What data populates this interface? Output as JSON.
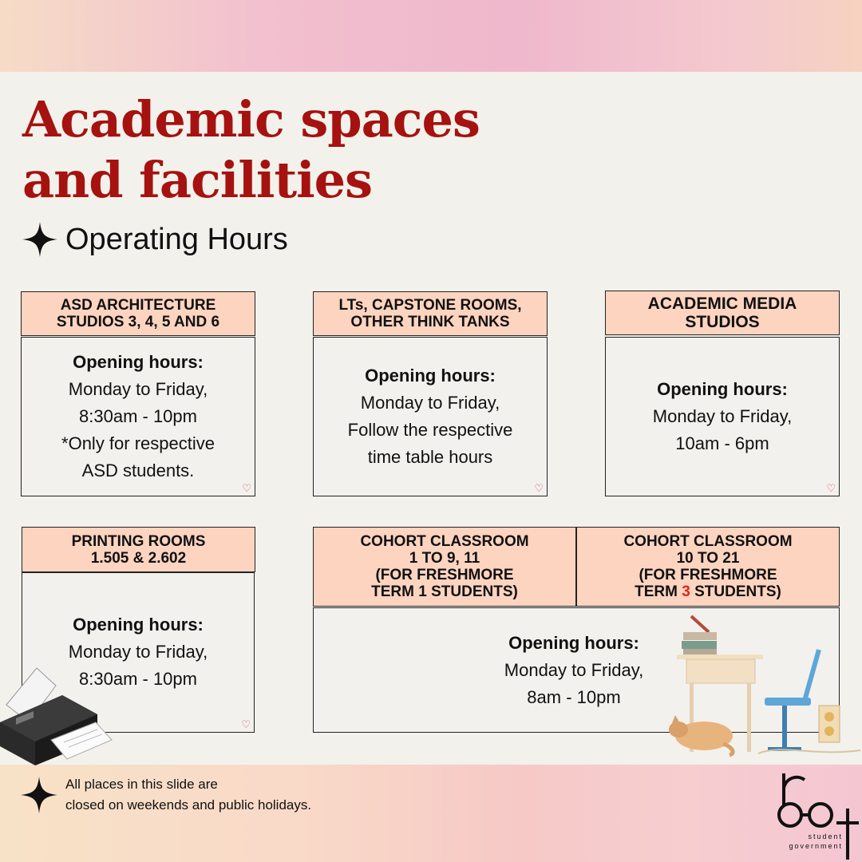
{
  "title": {
    "line1": "Academic spaces",
    "line2": "and facilities"
  },
  "subtitle": "Operating Hours",
  "colors": {
    "title": "#a5120f",
    "header_fill": "#fdd4c0",
    "highlight": "#e0241b"
  },
  "cards": [
    {
      "header": [
        "ASD ARCHITECTURE",
        "STUDIOS 3, 4, 5 AND 6"
      ],
      "body": [
        "Opening hours:",
        "Monday to Friday,",
        "8:30am - 10pm",
        "*Only for respective",
        "ASD students."
      ]
    },
    {
      "header": [
        "LTs, CAPSTONE ROOMS,",
        "OTHER THINK TANKS"
      ],
      "body": [
        "Opening hours:",
        "Monday to Friday,",
        "Follow the respective",
        "time table hours"
      ]
    },
    {
      "header": [
        "ACADEMIC MEDIA",
        "STUDIOS"
      ],
      "body": [
        "Opening hours:",
        "Monday to Friday,",
        "10am - 6pm"
      ]
    },
    {
      "header": [
        "PRINTING ROOMS",
        "1.505 & 2.602"
      ],
      "body": [
        "Opening hours:",
        "Monday to Friday,",
        "8:30am - 10pm"
      ]
    }
  ],
  "cohort": {
    "header_left": [
      "COHORT CLASSROOM",
      "1 TO 9, 11",
      "(FOR FRESHMORE",
      "TERM 1 STUDENTS)"
    ],
    "header_right": {
      "line1": "COHORT CLASSROOM",
      "line2": "10 TO 21",
      "line3": "(FOR FRESHMORE",
      "line4_pre": "TERM ",
      "line4_num": "3",
      "line4_post": " STUDENTS)"
    },
    "body": [
      "Opening hours:",
      "Monday to Friday,",
      "8am - 10pm"
    ]
  },
  "footnote": [
    "All places in this slide are",
    "closed on weekends and public holidays."
  ],
  "logo": {
    "mark": "root",
    "text_line1": "student",
    "text_line2": "government"
  },
  "icons": [
    "sparkle-star-icon",
    "heart-icon",
    "printer-icon",
    "classroom-desk-icon"
  ]
}
